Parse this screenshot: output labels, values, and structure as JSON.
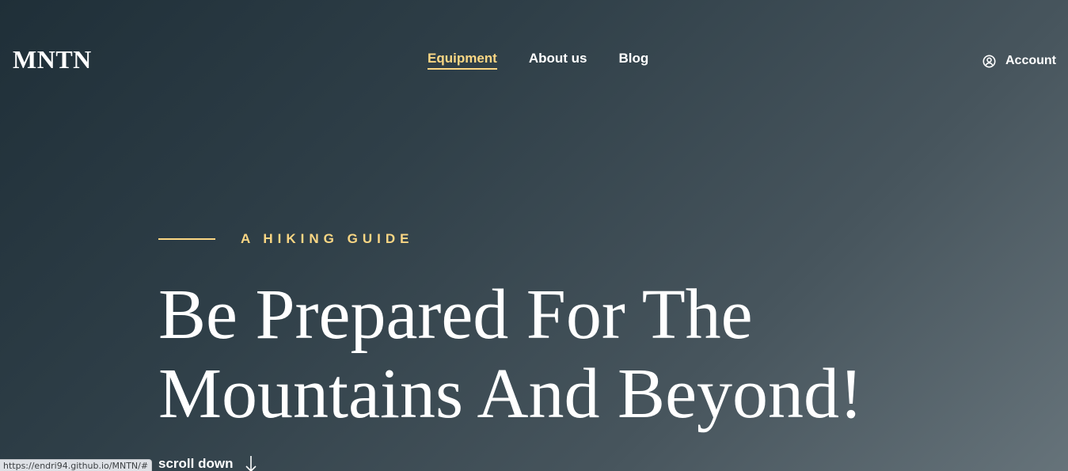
{
  "header": {
    "logo": "MNTN",
    "nav": [
      {
        "label": "Equipment",
        "active": true
      },
      {
        "label": "About us",
        "active": false
      },
      {
        "label": "Blog",
        "active": false
      }
    ],
    "account_label": "Account",
    "account_icon": "user-circle-icon"
  },
  "hero": {
    "eyebrow": "A HIKING GUIDE",
    "title_line1": "Be Prepared For The",
    "title_line2": "Mountains And Beyond!",
    "scroll_label": "scroll down",
    "scroll_icon": "arrow-down-icon"
  },
  "status_bar": {
    "url": "https://endri94.github.io/MNTN/#"
  },
  "colors": {
    "accent": "#fbd784",
    "text": "#ffffff",
    "background_dark": "#1f2f38",
    "background_light": "#66737a"
  }
}
